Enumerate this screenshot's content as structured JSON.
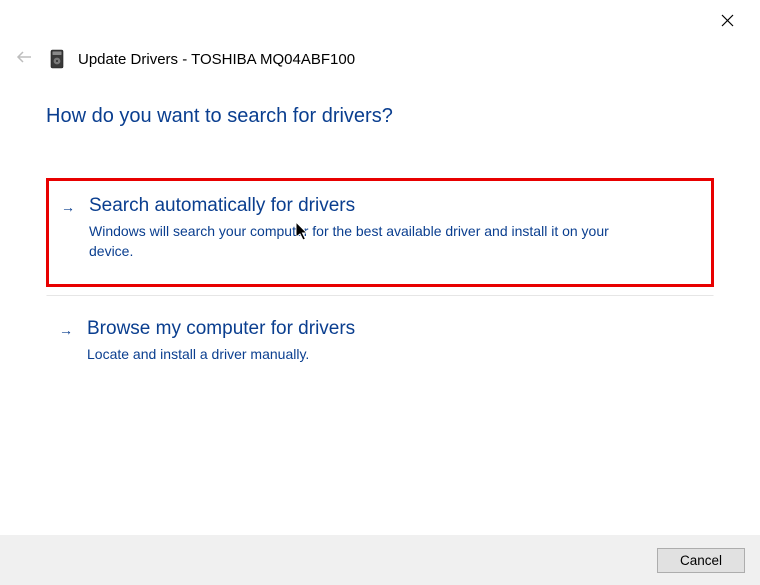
{
  "window": {
    "title": "Update Drivers - TOSHIBA MQ04ABF100"
  },
  "heading": "How do you want to search for drivers?",
  "options": [
    {
      "title": "Search automatically for drivers",
      "description": "Windows will search your computer for the best available driver and install it on your device."
    },
    {
      "title": "Browse my computer for drivers",
      "description": "Locate and install a driver manually."
    }
  ],
  "footer": {
    "cancel_label": "Cancel"
  }
}
